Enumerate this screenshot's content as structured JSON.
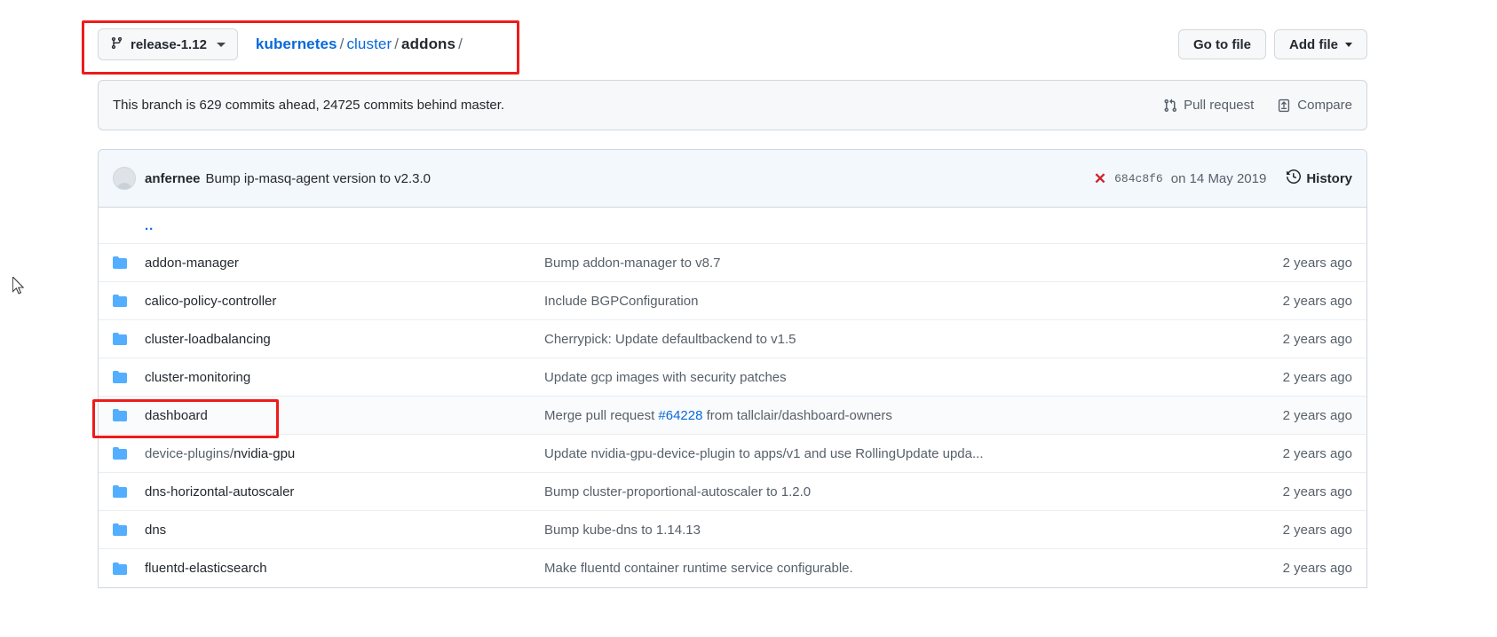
{
  "toolbar": {
    "branch_icon": "git-branch-icon",
    "branch_name": "release-1.12",
    "breadcrumb": {
      "repo": "kubernetes",
      "sep": "/",
      "parts": [
        "cluster",
        "addons"
      ],
      "trailing": "/"
    },
    "go_to_file_label": "Go to file",
    "add_file_label": "Add file"
  },
  "branch_status": {
    "message": "This branch is 629 commits ahead, 24725 commits behind master.",
    "pull_request_label": "Pull request",
    "compare_label": "Compare"
  },
  "latest_commit": {
    "author": "anfernee",
    "message": "Bump ip-masq-agent version to v2.3.0",
    "status_icon": "x-failure-icon",
    "status_color": "#cf222e",
    "sha": "684c8f6",
    "date": "on 14 May 2019",
    "history_label": "History",
    "history_icon": "history-clock-icon"
  },
  "files": {
    "parent_dir_label": "..",
    "rows": [
      {
        "icon": "folder-icon",
        "name": "addon-manager",
        "prefix": "",
        "message": "Bump addon-manager to v8.7",
        "pr": "",
        "message_tail": "",
        "age": "2 years ago",
        "highlighted": false
      },
      {
        "icon": "folder-icon",
        "name": "calico-policy-controller",
        "prefix": "",
        "message": "Include BGPConfiguration",
        "pr": "",
        "message_tail": "",
        "age": "2 years ago",
        "highlighted": false
      },
      {
        "icon": "folder-icon",
        "name": "cluster-loadbalancing",
        "prefix": "",
        "message": "Cherrypick: Update defaultbackend to v1.5",
        "pr": "",
        "message_tail": "",
        "age": "2 years ago",
        "highlighted": false
      },
      {
        "icon": "folder-icon",
        "name": "cluster-monitoring",
        "prefix": "",
        "message": "Update gcp images with security patches",
        "pr": "",
        "message_tail": "",
        "age": "2 years ago",
        "highlighted": false
      },
      {
        "icon": "folder-icon",
        "name": "dashboard",
        "prefix": "",
        "message": "Merge pull request ",
        "pr": "#64228",
        "message_tail": " from tallclair/dashboard-owners",
        "age": "2 years ago",
        "highlighted": true
      },
      {
        "icon": "folder-icon",
        "name": "nvidia-gpu",
        "prefix": "device-plugins/",
        "message": "Update nvidia-gpu-device-plugin to apps/v1 and use RollingUpdate upda...",
        "pr": "",
        "message_tail": "",
        "age": "2 years ago",
        "highlighted": false
      },
      {
        "icon": "folder-icon",
        "name": "dns-horizontal-autoscaler",
        "prefix": "",
        "message": "Bump cluster-proportional-autoscaler to 1.2.0",
        "pr": "",
        "message_tail": "",
        "age": "2 years ago",
        "highlighted": false
      },
      {
        "icon": "folder-icon",
        "name": "dns",
        "prefix": "",
        "message": "Bump kube-dns to 1.14.13",
        "pr": "",
        "message_tail": "",
        "age": "2 years ago",
        "highlighted": false
      },
      {
        "icon": "folder-icon",
        "name": "fluentd-elasticsearch",
        "prefix": "",
        "message": "Make fluentd container runtime service configurable.",
        "pr": "",
        "message_tail": "",
        "age": "2 years ago",
        "highlighted": false
      }
    ]
  },
  "annotations": {
    "branch_selector_box_color": "#ee1b1b",
    "dashboard_row_box_color": "#ee1b1b"
  },
  "colors": {
    "link": "#0969da",
    "folder": "#54aeff",
    "muted": "#57606a",
    "border": "#d0d7de",
    "commit_header_bg": "#f3f8fd"
  }
}
